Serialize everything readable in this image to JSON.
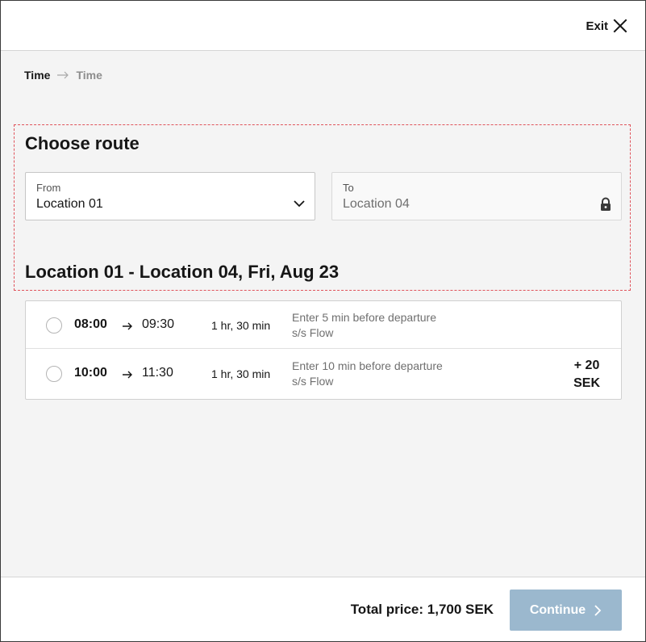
{
  "header": {
    "exit_label": "Exit",
    "exit_icon": "close-icon"
  },
  "breadcrumb": {
    "current": "Time",
    "next": "Time",
    "separator_icon": "arrow-right-icon"
  },
  "route": {
    "title": "Choose route",
    "from": {
      "label": "From",
      "value": "Location 01",
      "icon": "chevron-down-icon"
    },
    "to": {
      "label": "To",
      "value": "Location 04",
      "icon": "lock-icon"
    },
    "heading": "Location 01 - Location 04, Fri, Aug 23"
  },
  "departures": [
    {
      "depart": "08:00",
      "arrive": "09:30",
      "duration": "1 hr, 30 min",
      "note_line1": "Enter 5 min before departure",
      "note_line2": "s/s Flow",
      "surcharge_amount": "",
      "surcharge_currency": "",
      "selected": false
    },
    {
      "depart": "10:00",
      "arrive": "11:30",
      "duration": "1 hr, 30 min",
      "note_line1": "Enter 10 min before departure",
      "note_line2": "s/s Flow",
      "surcharge_amount": "+ 20",
      "surcharge_currency": "SEK",
      "selected": false
    }
  ],
  "footer": {
    "total_label": "Total price: 1,700 SEK",
    "continue_label": "Continue",
    "continue_icon": "chevron-right-icon",
    "continue_enabled": false
  },
  "colors": {
    "background": "#f4f4f4",
    "focus_outline": "#da1e28",
    "continue_disabled": "#9bb8ce"
  }
}
